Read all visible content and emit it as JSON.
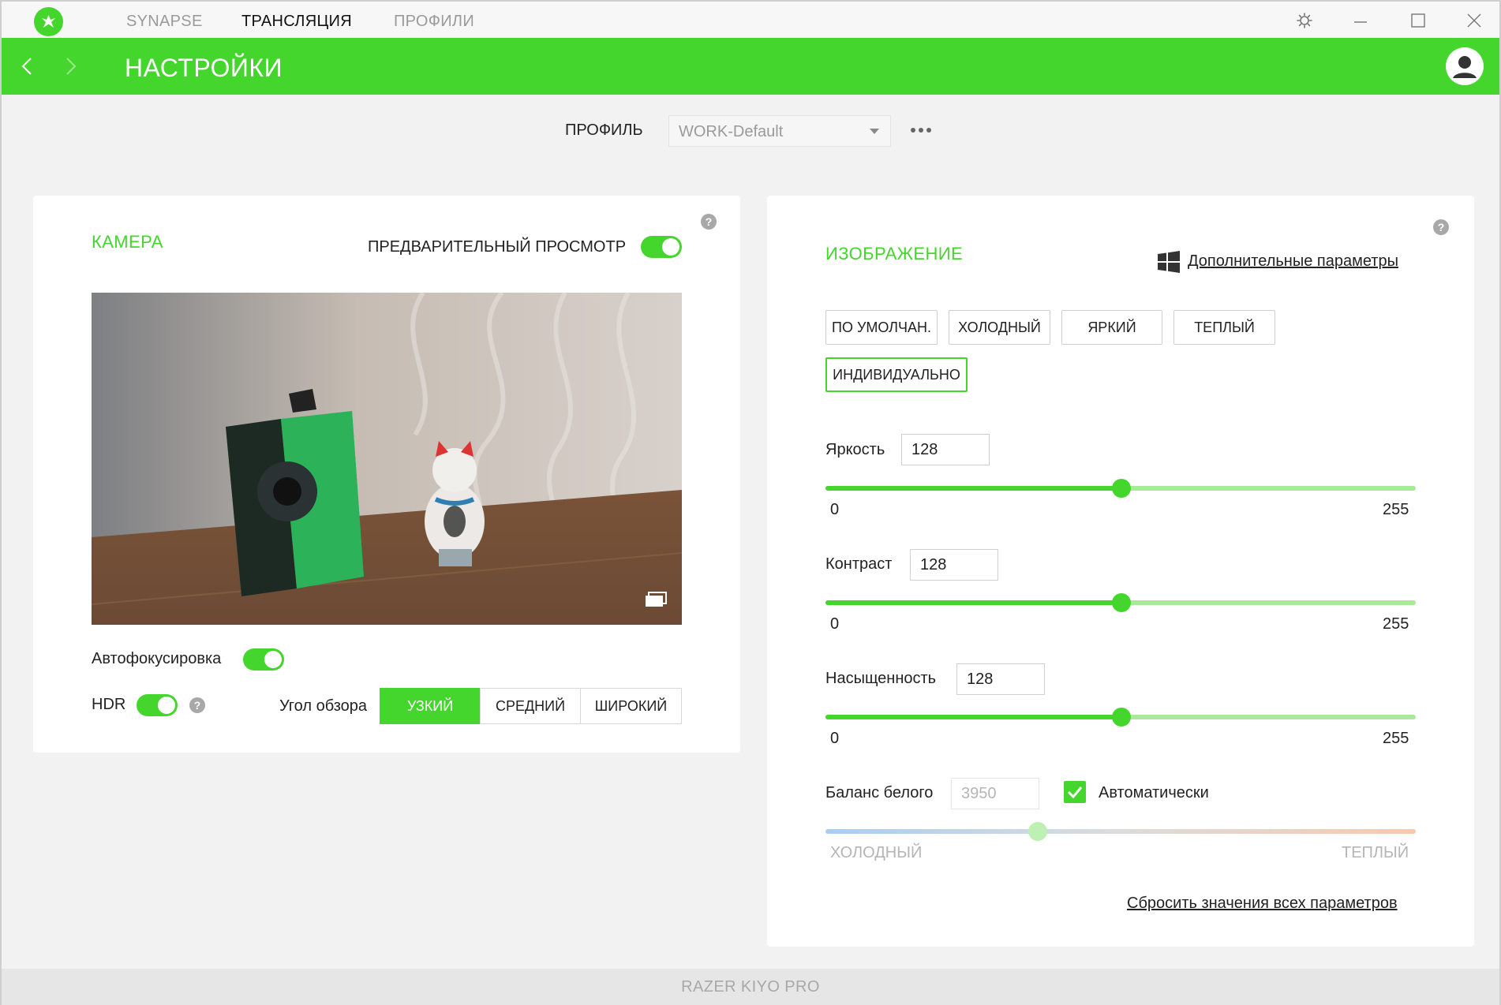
{
  "window": {
    "tabs": [
      {
        "label": "SYNAPSE",
        "active": false
      },
      {
        "label": "ТРАНСЛЯЦИЯ",
        "active": true
      },
      {
        "label": "ПРОФИЛИ",
        "active": false
      }
    ]
  },
  "header": {
    "title": "НАСТРОЙКИ"
  },
  "profile": {
    "label": "ПРОФИЛЬ",
    "selected": "WORK-Default"
  },
  "camera": {
    "title": "КАМЕРА",
    "preview_label": "ПРЕДВАРИТЕЛЬНЫЙ ПРОСМОТР",
    "preview_on": true,
    "autofocus_label": "Автофокусировка",
    "autofocus_on": true,
    "hdr_label": "HDR",
    "hdr_on": true,
    "fov_label": "Угол обзора",
    "fov_options": [
      "УЗКИЙ",
      "СРЕДНИЙ",
      "ШИРОКИЙ"
    ],
    "fov_selected": "УЗКИЙ",
    "help": "?"
  },
  "image": {
    "title": "ИЗОБРАЖЕНИЕ",
    "advanced_link": "Дополнительные параметры",
    "help": "?",
    "presets": [
      "ПО УМОЛЧАН.",
      "ХОЛОДНЫЙ",
      "ЯРКИЙ",
      "ТЕПЛЫЙ",
      "ИНДИВИДУАЛЬНО"
    ],
    "preset_selected": "ИНДИВИДУАЛЬНО",
    "brightness": {
      "label": "Яркость",
      "value": "128",
      "min": "0",
      "max": "255"
    },
    "contrast": {
      "label": "Контраст",
      "value": "128",
      "min": "0",
      "max": "255"
    },
    "saturation": {
      "label": "Насыщенность",
      "value": "128",
      "min": "0",
      "max": "255"
    },
    "white_balance": {
      "label": "Баланс белого",
      "value": "3950",
      "auto_label": "Автоматически",
      "auto": true,
      "min_label": "ХОЛОДНЫЙ",
      "max_label": "ТЕПЛЫЙ",
      "level": 0.36
    },
    "reset_link": "Сбросить значения всех параметров"
  },
  "footer": {
    "device": "RAZER KIYO PRO"
  },
  "colors": {
    "accent": "#44d62c"
  }
}
